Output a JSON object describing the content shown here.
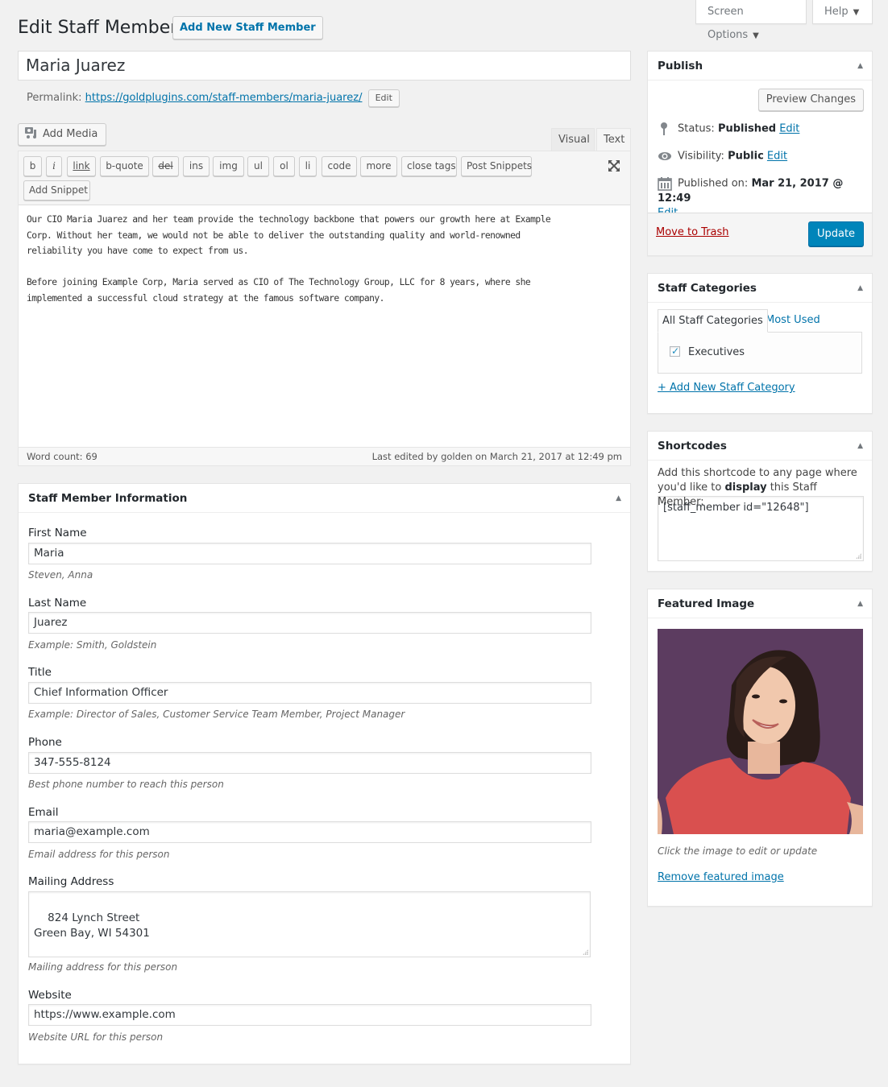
{
  "screen_meta": {
    "screen_options": "Screen Options",
    "help": "Help"
  },
  "header": {
    "title": "Edit Staff Member",
    "add_new_label": "Add New Staff Member"
  },
  "post": {
    "title": "Maria Juarez",
    "permalink_label": "Permalink:",
    "permalink_base": "https://goldplugins.com/staff-members/",
    "permalink_slug": "maria-juarez",
    "permalink_trail": "/",
    "permalink_edit": "Edit"
  },
  "editor": {
    "add_media": "Add Media",
    "tabs": {
      "visual": "Visual",
      "text": "Text"
    },
    "quicktags": [
      "b",
      "i",
      "link",
      "b-quote",
      "del",
      "ins",
      "img",
      "ul",
      "ol",
      "li",
      "code",
      "more",
      "close tags",
      "Post Snippets",
      "Add Snippet"
    ],
    "content": "Our CIO Maria Juarez and her team provide the technology backbone that powers our growth here at Example\nCorp. Without her team, we would not be able to deliver the outstanding quality and world-renowned\nreliability you have come to expect from us.\n\nBefore joining Example Corp, Maria served as CIO of The Technology Group, LLC for 8 years, where she\nimplemented a successful cloud strategy at the famous software company.",
    "word_count": "Word count: 69",
    "last_edited": "Last edited by golden on March 21, 2017 at 12:49 pm"
  },
  "staff_info": {
    "title": "Staff Member Information",
    "fields": [
      {
        "label": "First Name",
        "value": "Maria",
        "description": "Steven, Anna"
      },
      {
        "label": "Last Name",
        "value": "Juarez",
        "description": "Example: Smith, Goldstein"
      },
      {
        "label": "Title",
        "value": "Chief Information Officer",
        "description": "Example: Director of Sales, Customer Service Team Member, Project Manager"
      },
      {
        "label": "Phone",
        "value": "347-555-8124",
        "description": "Best phone number to reach this person"
      },
      {
        "label": "Email",
        "value": "maria@example.com",
        "description": "Email address for this person"
      },
      {
        "label": "Mailing Address",
        "value": "824 Lynch Street\nGreen Bay, WI 54301",
        "description": "Mailing address for this person"
      },
      {
        "label": "Website",
        "value": "https://www.example.com",
        "description": "Website URL for this person"
      }
    ]
  },
  "publish": {
    "title": "Publish",
    "preview_label": "Preview Changes",
    "status_label": "Status:",
    "status_value": "Published",
    "visibility_label": "Visibility:",
    "visibility_value": "Public",
    "published_label": "Published on:",
    "published_value": "Mar 21, 2017 @ 12:49",
    "edit_label": "Edit",
    "trash_label": "Move to Trash",
    "update_label": "Update"
  },
  "categories": {
    "title": "Staff Categories",
    "tab_all": "All Staff Categories",
    "tab_most": "Most Used",
    "items": [
      {
        "label": "Executives",
        "checked": true
      }
    ],
    "add_new": "+ Add New Staff Category"
  },
  "shortcodes": {
    "title": "Shortcodes",
    "description_pre": "Add this shortcode to any page where you'd like to ",
    "description_bold": "display",
    "description_post": " this Staff Member:",
    "code": "[staff_member id=\"12648\"]"
  },
  "featured_image": {
    "title": "Featured Image",
    "description": "Click the image to edit or update",
    "remove_label": "Remove featured image"
  },
  "colors": {
    "link": "#0073aa",
    "primary_button": "#0085ba",
    "trash": "#aa0000",
    "background": "#f1f1f1"
  }
}
